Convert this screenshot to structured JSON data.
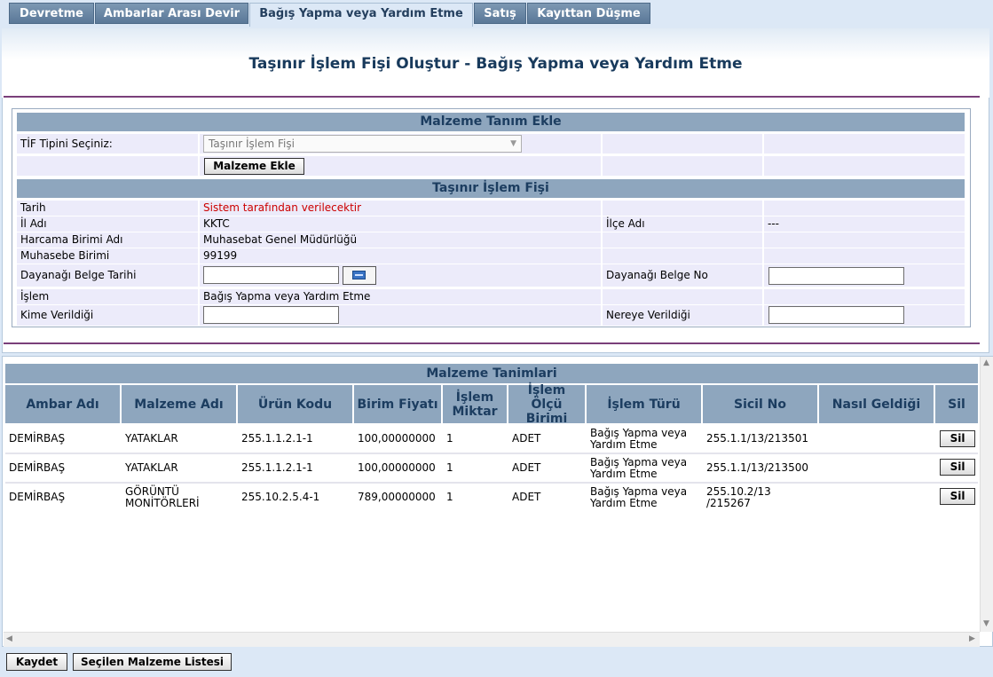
{
  "tabs": [
    {
      "label": "Devretme"
    },
    {
      "label": "Ambarlar Arası Devir"
    },
    {
      "label": "Bağış Yapma veya Yardım Etme"
    },
    {
      "label": "Satış"
    },
    {
      "label": "Kayıttan Düşme"
    }
  ],
  "active_tab": "Bağış Yapma veya Yardım Etme",
  "page_title": "Taşınır İşlem Fişi Oluştur - Bağış Yapma veya Yardım Etme",
  "malzeme_tanim_ekle": {
    "header": "Malzeme Tanım Ekle",
    "tif_label": "TİF Tipini Seçiniz:",
    "tif_selected": "Taşınır İşlem Fişi",
    "add_button": "Malzeme Ekle"
  },
  "tif": {
    "header": "Taşınır İşlem Fişi",
    "tarih_label": "Tarih",
    "tarih_value": "Sistem tarafından verilecektir",
    "il_label": "İl Adı",
    "il_value": "KKTC",
    "ilce_label": "İlçe Adı",
    "ilce_value": "---",
    "harcama_label": "Harcama Birimi Adı",
    "harcama_value": "Muhasebat Genel Müdürlüğü",
    "muhasebe_label": "Muhasebe Birimi",
    "muhasebe_value": "99199",
    "dayanak_tarih_label": "Dayanağı Belge Tarihi",
    "dayanak_tarih_value": "",
    "dayanak_no_label": "Dayanağı Belge No",
    "dayanak_no_value": "",
    "islem_label": "İşlem",
    "islem_value": "Bağış Yapma veya Yardım Etme",
    "kime_label": "Kime Verildiği",
    "kime_value": "",
    "nereye_label": "Nereye Verildiği",
    "nereye_value": ""
  },
  "table": {
    "title": "Malzeme Tanimlari",
    "columns": [
      "Ambar Adı",
      "Malzeme Adı",
      "Ürün Kodu",
      "Birim Fiyatı",
      "İşlem Miktar",
      "İşlem Ölçü Birimi",
      "İşlem Türü",
      "Sicil No",
      "Nasıl Geldiği",
      "Sil"
    ],
    "rows": [
      {
        "ambar": "DEMİRBAŞ",
        "malzeme": "YATAKLAR",
        "kod": "255.1.1.2.1-1",
        "fiyat": "100,00000000",
        "miktar": "1",
        "birim": "ADET",
        "tur": "Bağış Yapma veya Yardım Etme",
        "sicil": "255.1.1/13/213501",
        "nasil": "",
        "sil": "Sil"
      },
      {
        "ambar": "DEMİRBAŞ",
        "malzeme": "YATAKLAR",
        "kod": "255.1.1.2.1-1",
        "fiyat": "100,00000000",
        "miktar": "1",
        "birim": "ADET",
        "tur": "Bağış Yapma veya Yardım Etme",
        "sicil": "255.1.1/13/213500",
        "nasil": "",
        "sil": "Sil"
      },
      {
        "ambar": "DEMİRBAŞ",
        "malzeme": "GÖRÜNTÜ MONİTÖRLERİ",
        "kod": "255.10.2.5.4-1",
        "fiyat": "789,00000000",
        "miktar": "1",
        "birim": "ADET",
        "tur": "Bağış Yapma veya Yardım Etme",
        "sicil": "255.10.2/13 /215267",
        "nasil": "",
        "sil": "Sil"
      }
    ]
  },
  "footer": {
    "save_button": "Kaydet",
    "list_button": "Seçilen Malzeme Listesi"
  }
}
